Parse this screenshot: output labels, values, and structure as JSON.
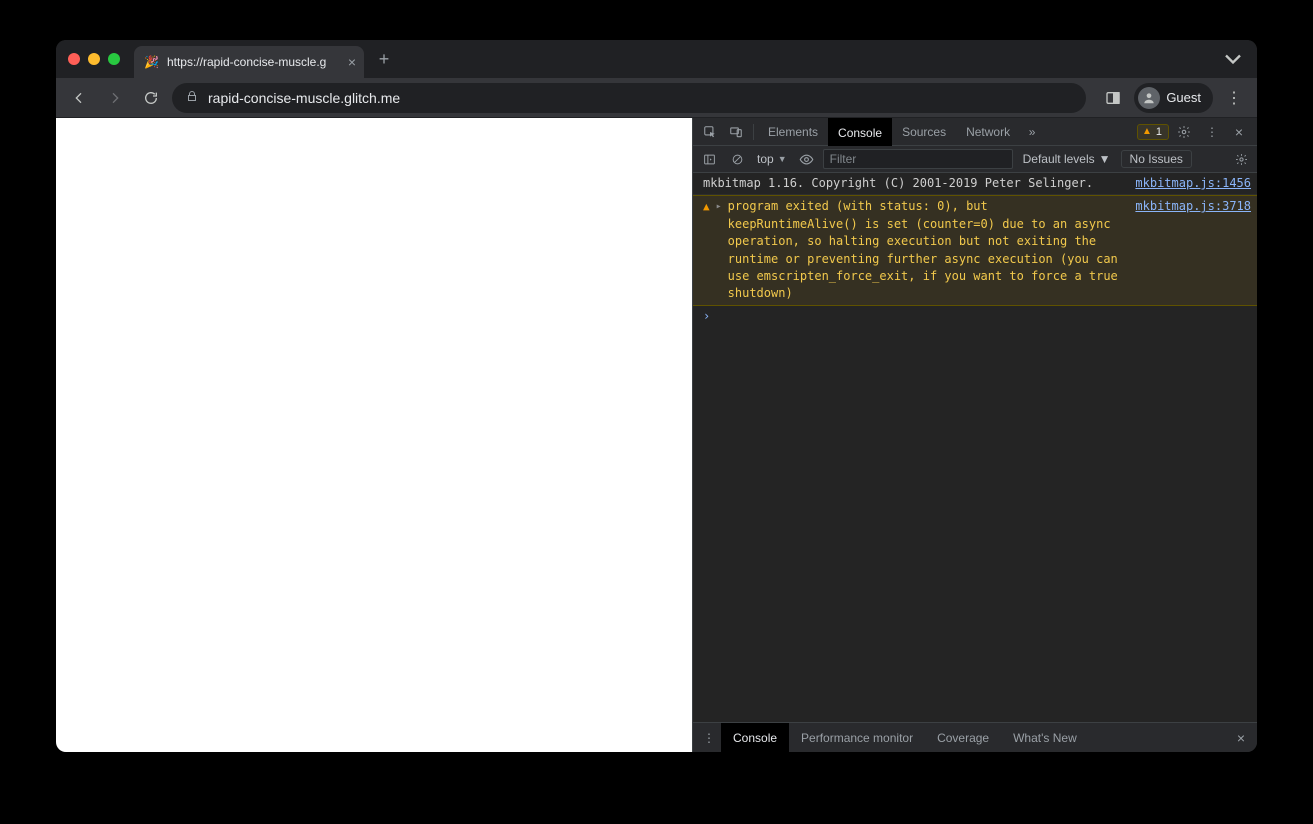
{
  "tab": {
    "title": "https://rapid-concise-muscle.g",
    "favicon": "🎉"
  },
  "addressbar": {
    "url": "rapid-concise-muscle.glitch.me"
  },
  "profile": {
    "label": "Guest"
  },
  "devtools": {
    "tabs": [
      "Elements",
      "Console",
      "Sources",
      "Network"
    ],
    "active_tab": "Console",
    "warn_count": "1",
    "console_toolbar": {
      "context": "top",
      "filter_placeholder": "Filter",
      "levels": "Default levels",
      "issues": "No Issues"
    },
    "logs": [
      {
        "type": "info",
        "msg": "mkbitmap 1.16. Copyright (C) 2001-2019 Peter Selinger.",
        "src": "mkbitmap.js:1456"
      },
      {
        "type": "warn",
        "msg": "program exited (with status: 0), but keepRuntimeAlive() is set (counter=0) due to an async operation, so halting execution but not exiting the runtime or preventing further async execution (you can use emscripten_force_exit, if you want to force a true shutdown)",
        "src": "mkbitmap.js:3718"
      }
    ],
    "prompt": "›",
    "drawer_tabs": [
      "Console",
      "Performance monitor",
      "Coverage",
      "What's New"
    ],
    "drawer_active": "Console"
  }
}
